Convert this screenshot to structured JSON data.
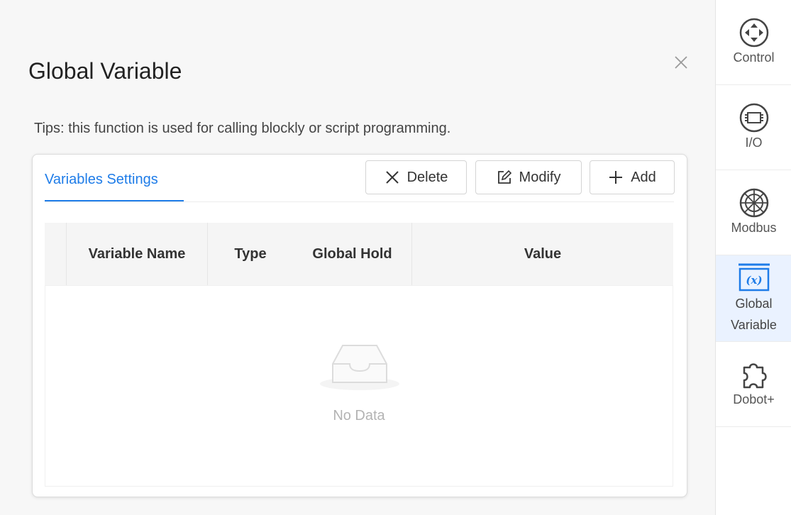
{
  "dialog": {
    "title": "Global Variable",
    "tips": "Tips: this function is used for calling blockly or script programming.",
    "close_icon": "close-icon"
  },
  "tabs": [
    {
      "label": "Variables Settings",
      "active": true
    }
  ],
  "toolbar": {
    "delete_label": "Delete",
    "modify_label": "Modify",
    "add_label": "Add"
  },
  "table": {
    "columns": [
      "",
      "Variable Name",
      "Type",
      "Global Hold",
      "Value"
    ],
    "rows": [],
    "empty_text": "No Data"
  },
  "sidebar": {
    "items": [
      {
        "label": "Control",
        "icon": "control-icon",
        "active": false
      },
      {
        "label": "I/O",
        "icon": "io-icon",
        "active": false
      },
      {
        "label": "Modbus",
        "icon": "modbus-icon",
        "active": false
      },
      {
        "label": "Global\nVariable",
        "icon": "global-variable-icon",
        "active": true
      },
      {
        "label": "Dobot+",
        "icon": "puzzle-icon",
        "active": false
      }
    ]
  },
  "colors": {
    "accent": "#1e7ce8",
    "panel_bg": "#f7f7f7",
    "active_sidebar_bg": "#eaf2ff"
  }
}
